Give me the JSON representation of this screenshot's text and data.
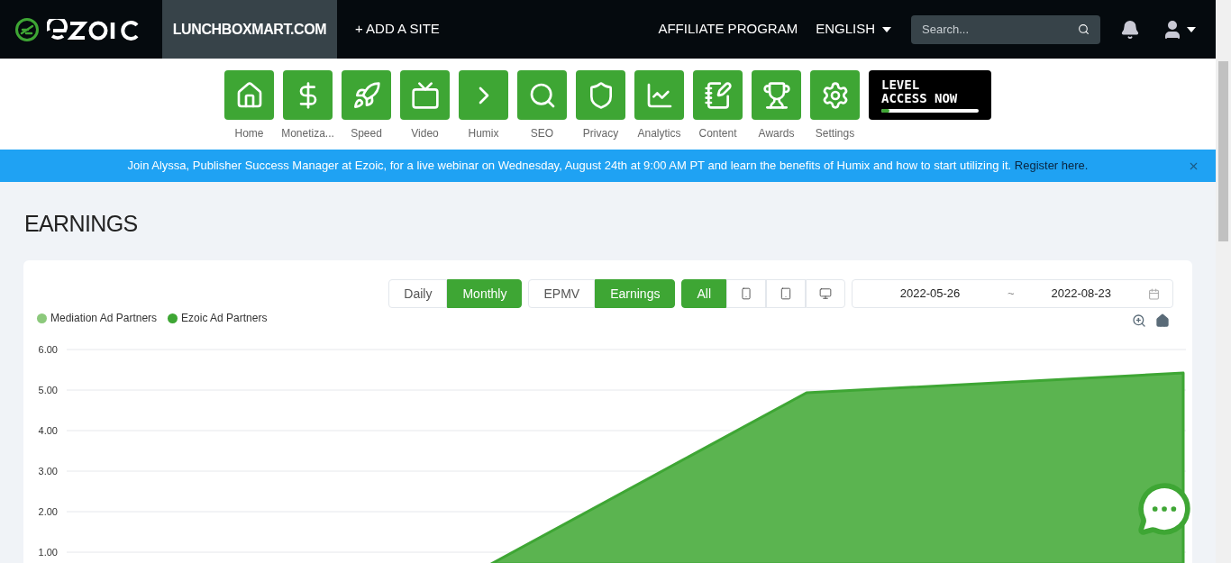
{
  "header": {
    "sites": [
      {
        "label": "LUNCHBOXMART.COM",
        "selected": true
      }
    ],
    "add_site": "+ ADD A SITE",
    "affiliate": "AFFILIATE PROGRAM",
    "language": "ENGLISH",
    "search": {
      "placeholder": "Search..."
    }
  },
  "nav": [
    {
      "kind": "home",
      "label": "Home"
    },
    {
      "kind": "dollar",
      "label": "Monetiza..."
    },
    {
      "kind": "rocket",
      "label": "Speed"
    },
    {
      "kind": "video",
      "label": "Video"
    },
    {
      "kind": "chevron",
      "label": "Humix"
    },
    {
      "kind": "search",
      "label": "SEO"
    },
    {
      "kind": "shield",
      "label": "Privacy"
    },
    {
      "kind": "chart",
      "label": "Analytics"
    },
    {
      "kind": "document",
      "label": "Content"
    },
    {
      "kind": "trophy",
      "label": "Awards"
    },
    {
      "kind": "gear",
      "label": "Settings"
    }
  ],
  "level_badge": {
    "line1": "LEVEL",
    "line2": "ACCESS NOW",
    "level": 0.08
  },
  "banner": {
    "text": "Join Alyssa, Publisher Success Manager at Ezoic, for a live webinar on Wednesday, August 24th at 9:00 AM PT and learn the benefits of Humix and how to start utilizing it.",
    "link": "Register here."
  },
  "page_title": "EARNINGS",
  "period": [
    {
      "label": "Daily",
      "selected": false
    },
    {
      "label": "Monthly",
      "selected": true
    }
  ],
  "metric": [
    {
      "label": "EPMV",
      "selected": false
    },
    {
      "label": "Earnings",
      "selected": true
    }
  ],
  "devices": [
    {
      "kind": "all",
      "label": "All",
      "selected": true
    },
    {
      "kind": "phone",
      "selected": false
    },
    {
      "kind": "tablet",
      "selected": false
    },
    {
      "kind": "desktop",
      "selected": false
    }
  ],
  "date_range": {
    "start": "2022-05-26",
    "separator": "~",
    "end": "2022-08-23"
  },
  "legend": [
    {
      "label": "Mediation Ad Partners",
      "color": "#8cc97c"
    },
    {
      "label": "Ezoic Ad Partners",
      "color": "#3ea634"
    }
  ],
  "chart": {
    "y_labels": [
      "6.00",
      "5.00",
      "4.00",
      "3.00",
      "2.00",
      "1.00"
    ]
  }
}
